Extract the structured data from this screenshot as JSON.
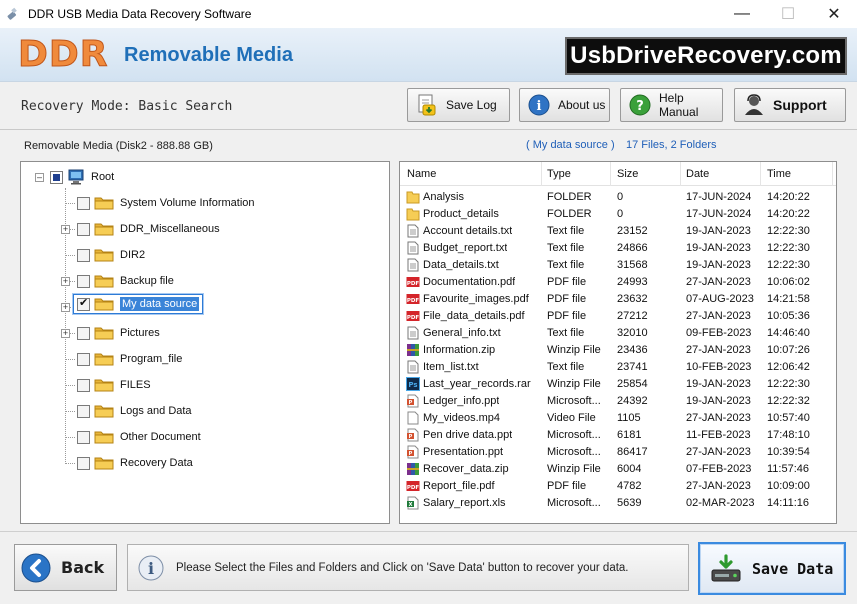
{
  "window": {
    "title": "DDR USB Media Data Recovery Software",
    "controls": [
      "—",
      "☐",
      "✕"
    ]
  },
  "banner": {
    "logo": "DDR",
    "product": "Removable Media",
    "site": "UsbDriveRecovery.com"
  },
  "toolbar": {
    "mode": "Recovery Mode: Basic Search",
    "save_log": "Save Log",
    "about": "About us",
    "help": "Help Manual",
    "support": "Support"
  },
  "main": {
    "media_label": "Removable Media (Disk2 - 888.88 GB)",
    "source_label": "( My data source )",
    "files_count": "17 Files, 2 Folders"
  },
  "tree": {
    "root": "Root",
    "nodes": [
      {
        "label": "System Volume Information",
        "expandable": false,
        "checked": false
      },
      {
        "label": "DDR_Miscellaneous",
        "expandable": true,
        "checked": false
      },
      {
        "label": "DIR2",
        "expandable": false,
        "checked": false
      },
      {
        "label": "Backup file",
        "expandable": true,
        "checked": false
      },
      {
        "label": "My data source",
        "expandable": true,
        "checked": true,
        "selected": true
      },
      {
        "label": "Pictures",
        "expandable": true,
        "checked": false
      },
      {
        "label": "Program_file",
        "expandable": false,
        "checked": false
      },
      {
        "label": "FILES",
        "expandable": false,
        "checked": false
      },
      {
        "label": "Logs and Data",
        "expandable": false,
        "checked": false
      },
      {
        "label": "Other Document",
        "expandable": false,
        "checked": false
      },
      {
        "label": "Recovery Data",
        "expandable": false,
        "checked": false
      }
    ]
  },
  "list": {
    "columns": {
      "name": "Name",
      "type": "Type",
      "size": "Size",
      "date": "Date",
      "time": "Time"
    },
    "rows": [
      {
        "icon": "folder-icon",
        "name": "Analysis",
        "type": "FOLDER",
        "size": "0",
        "date": "17-JUN-2024",
        "time": "14:20:22"
      },
      {
        "icon": "folder-icon",
        "name": "Product_details",
        "type": "FOLDER",
        "size": "0",
        "date": "17-JUN-2024",
        "time": "14:20:22"
      },
      {
        "icon": "text-file-icon",
        "name": "Account details.txt",
        "type": "Text file",
        "size": "23152",
        "date": "19-JAN-2023",
        "time": "12:22:30"
      },
      {
        "icon": "text-file-icon",
        "name": "Budget_report.txt",
        "type": "Text file",
        "size": "24866",
        "date": "19-JAN-2023",
        "time": "12:22:30"
      },
      {
        "icon": "text-file-icon",
        "name": "Data_details.txt",
        "type": "Text file",
        "size": "31568",
        "date": "19-JAN-2023",
        "time": "12:22:30"
      },
      {
        "icon": "pdf-file-icon",
        "name": "Documentation.pdf",
        "type": "PDF file",
        "size": "24993",
        "date": "27-JAN-2023",
        "time": "10:06:02"
      },
      {
        "icon": "pdf-file-icon",
        "name": "Favourite_images.pdf",
        "type": "PDF file",
        "size": "23632",
        "date": "07-AUG-2023",
        "time": "14:21:58"
      },
      {
        "icon": "pdf-file-icon",
        "name": "File_data_details.pdf",
        "type": "PDF file",
        "size": "27212",
        "date": "27-JAN-2023",
        "time": "10:05:36"
      },
      {
        "icon": "text-file-icon",
        "name": "General_info.txt",
        "type": "Text file",
        "size": "32010",
        "date": "09-FEB-2023",
        "time": "14:46:40"
      },
      {
        "icon": "zip-file-icon",
        "name": "Information.zip",
        "type": "Winzip File",
        "size": "23436",
        "date": "27-JAN-2023",
        "time": "10:07:26"
      },
      {
        "icon": "text-file-icon",
        "name": "Item_list.txt",
        "type": "Text file",
        "size": "23741",
        "date": "10-FEB-2023",
        "time": "12:06:42"
      },
      {
        "icon": "psd-file-icon",
        "name": "Last_year_records.rar",
        "type": "Winzip File",
        "size": "25854",
        "date": "19-JAN-2023",
        "time": "12:22:30"
      },
      {
        "icon": "ppt-file-icon",
        "name": "Ledger_info.ppt",
        "type": "Microsoft...",
        "size": "24392",
        "date": "19-JAN-2023",
        "time": "12:22:32"
      },
      {
        "icon": "video-file-icon",
        "name": "My_videos.mp4",
        "type": "Video File",
        "size": "1105",
        "date": "27-JAN-2023",
        "time": "10:57:40"
      },
      {
        "icon": "ppt-file-icon",
        "name": "Pen drive data.ppt",
        "type": "Microsoft...",
        "size": "6181",
        "date": "11-FEB-2023",
        "time": "17:48:10"
      },
      {
        "icon": "ppt-file-icon",
        "name": "Presentation.ppt",
        "type": "Microsoft...",
        "size": "86417",
        "date": "27-JAN-2023",
        "time": "10:39:54"
      },
      {
        "icon": "zip-file-icon",
        "name": "Recover_data.zip",
        "type": "Winzip File",
        "size": "6004",
        "date": "07-FEB-2023",
        "time": "11:57:46"
      },
      {
        "icon": "pdf-file-icon",
        "name": "Report_file.pdf",
        "type": "PDF file",
        "size": "4782",
        "date": "27-JAN-2023",
        "time": "10:09:00"
      },
      {
        "icon": "xls-file-icon",
        "name": "Salary_report.xls",
        "type": "Microsoft...",
        "size": "5639",
        "date": "02-MAR-2023",
        "time": "14:11:16"
      }
    ]
  },
  "bottom": {
    "back": "Back",
    "message": "Please Select the Files and Folders and Click on 'Save Data' button to recover your data.",
    "save": "Save Data"
  },
  "colors": {
    "accent": "#1f6fb8",
    "logo": "#f08a3c",
    "selection": "#3a84d8"
  }
}
